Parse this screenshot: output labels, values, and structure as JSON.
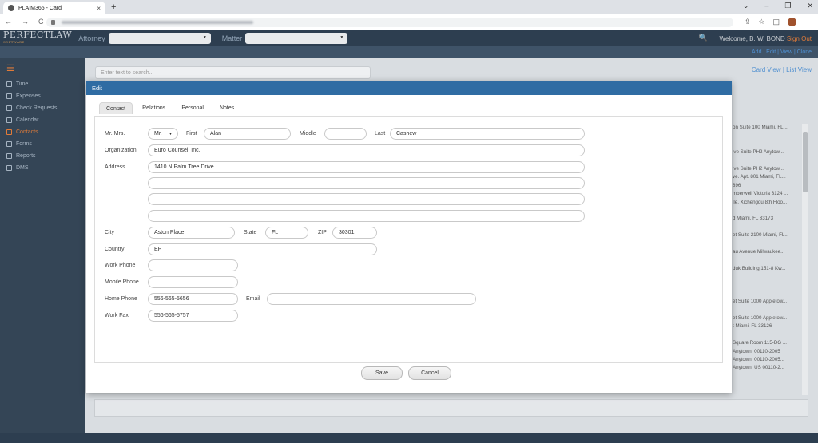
{
  "browser": {
    "tab_title": "PLAIM365 - Card",
    "tab_close": "×",
    "new_tab": "+",
    "window_controls": [
      "⌄",
      "–",
      "❐",
      "✕"
    ],
    "nav": [
      "←",
      "→",
      "C"
    ],
    "right_icons": [
      "⇪",
      "☆",
      "◫"
    ]
  },
  "header": {
    "logo": "PERFECTLAW",
    "logo_sub": "SOFTWARE",
    "attorney_label": "Attorney",
    "matter_label": "Matter",
    "search_icon": "🔍",
    "welcome": "Welcome, B. W. BOND",
    "sign_out": "Sign Out"
  },
  "subheader_links": "Add | Edit | View | Clone",
  "sidebar": {
    "menu_icon": "☰",
    "items": [
      "Time",
      "Expenses",
      "Check Requests",
      "Calendar",
      "Contacts",
      "Forms",
      "Reports",
      "DMS"
    ],
    "active": "Contacts"
  },
  "background": {
    "search_placeholder": "Enter text to search...",
    "view_links": "Card View | List View",
    "rows": [
      "on Suite 100 Miami, FL...",
      "",
      "",
      "ive Suite PH2 Anytow...",
      "",
      "ive Suite PH2 Anytow...",
      "ve. Apt. 801 Miami, FL...",
      "896",
      "mberwell Victoria 3124 ...",
      "ile, Xichengqu 8th Floo...",
      "",
      "d Miami, FL 33173",
      "",
      "et Suite 2100 Miami, FL...",
      "",
      "au Avenue Milwaukee...",
      "",
      "duk Building 151-8 Kw...",
      "",
      "",
      "",
      "et Suite 1000 Appletow...",
      "",
      "et Suite 1000 Appletow...",
      "t Miami, FL 33126",
      "",
      "Square Room 115-DG ...",
      "Anytown, 00110-2005",
      "Anytown, 00110-2005...",
      "Anytown, US 00110-2..."
    ]
  },
  "modal": {
    "title": "Edit",
    "tabs": [
      "Contact",
      "Relations",
      "Personal",
      "Notes"
    ],
    "active_tab": "Contact",
    "labels": {
      "salutation": "Mr. Mrs.",
      "first": "First",
      "middle": "Middle",
      "last": "Last",
      "organization": "Organization",
      "address": "Address",
      "city": "City",
      "state": "State",
      "zip": "ZIP",
      "country": "Country",
      "work_phone": "Work Phone",
      "mobile_phone": "Mobile Phone",
      "home_phone": "Home Phone",
      "email": "Email",
      "work_fax": "Work Fax"
    },
    "values": {
      "salutation": "Mr.",
      "first": "Alan",
      "middle": "",
      "last": "Cashew",
      "organization": "Euro Counsel, Inc.",
      "address1": "1410 N Palm Tree Drive",
      "address2": "",
      "address3": "",
      "address4": "",
      "city": "Aston Place",
      "state": "FL",
      "zip": "30301",
      "country": "EP",
      "work_phone": "",
      "mobile_phone": "",
      "home_phone": "556-565-5656",
      "email": "",
      "work_fax": "556-565-5757"
    },
    "buttons": {
      "save": "Save",
      "cancel": "Cancel"
    }
  }
}
